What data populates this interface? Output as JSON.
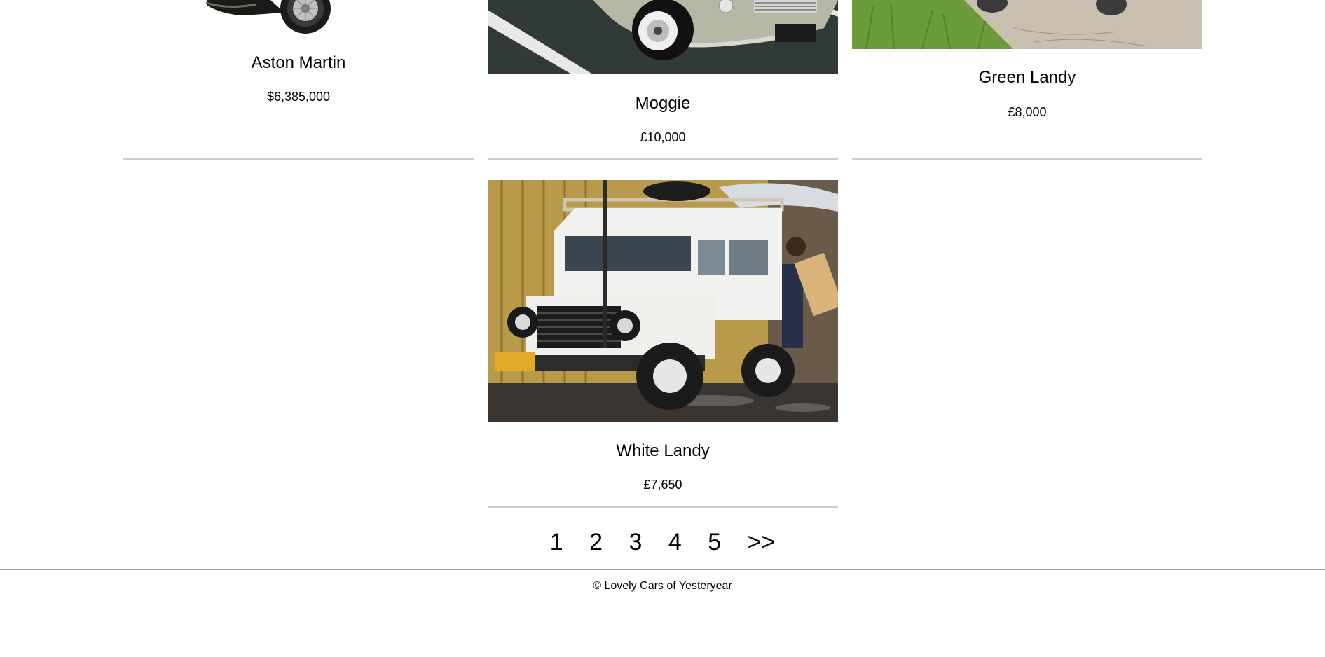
{
  "products": [
    {
      "title": "Aston Martin",
      "price": "$6,385,000"
    },
    {
      "title": "Moggie",
      "price": "£10,000"
    },
    {
      "title": "Green Landy",
      "price": "£8,000"
    },
    {
      "title": "White Landy",
      "price": "£7,650"
    }
  ],
  "pagination": {
    "pages": [
      "1",
      "2",
      "3",
      "4",
      "5"
    ],
    "next": ">>"
  },
  "footer": {
    "copyright": "© Lovely Cars of Yesteryear"
  }
}
